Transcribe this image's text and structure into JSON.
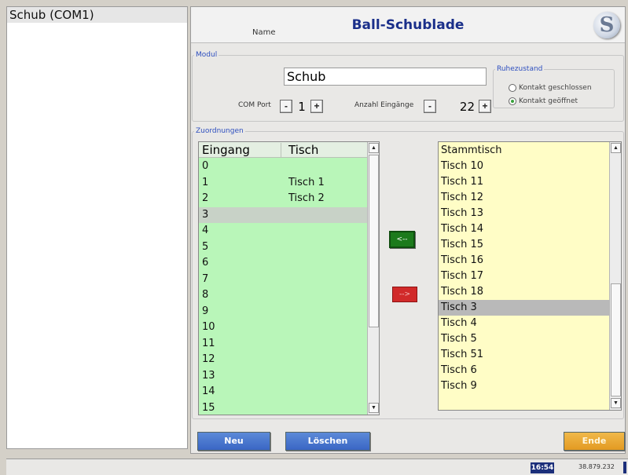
{
  "left_panel": {
    "items": [
      "Schub (COM1)"
    ]
  },
  "header": {
    "title": "Ball-Schublade",
    "logo_text": "S"
  },
  "modul": {
    "legend": "Modul",
    "name_label": "Name",
    "name_value": "Schub",
    "comport_label": "COM Port",
    "comport_value": "1",
    "inputs_label": "Anzahl Eingänge",
    "inputs_value": "22",
    "minus": "-",
    "plus": "+",
    "ruhezustand": {
      "legend": "Ruhezustand",
      "option_closed": "Kontakt geschlossen",
      "option_open": "Kontakt geöffnet",
      "selected": "open"
    }
  },
  "zuordnungen": {
    "legend": "Zuordnungen",
    "headers": [
      "Eingang",
      "Tisch"
    ],
    "eingang_rows": [
      {
        "e": "0",
        "t": ""
      },
      {
        "e": "1",
        "t": "Tisch 1"
      },
      {
        "e": "2",
        "t": "Tisch 2"
      },
      {
        "e": "3",
        "t": ""
      },
      {
        "e": "4",
        "t": ""
      },
      {
        "e": "5",
        "t": ""
      },
      {
        "e": "6",
        "t": ""
      },
      {
        "e": "7",
        "t": ""
      },
      {
        "e": "8",
        "t": ""
      },
      {
        "e": "9",
        "t": ""
      },
      {
        "e": "10",
        "t": ""
      },
      {
        "e": "11",
        "t": ""
      },
      {
        "e": "12",
        "t": ""
      },
      {
        "e": "13",
        "t": ""
      },
      {
        "e": "14",
        "t": ""
      },
      {
        "e": "15",
        "t": ""
      }
    ],
    "eingang_selected": "3",
    "assign_label": "<--",
    "remove_label": "-->",
    "tisch_rows": [
      "Stammtisch",
      "Tisch 10",
      "Tisch 11",
      "Tisch 12",
      "Tisch 13",
      "Tisch 14",
      "Tisch 15",
      "Tisch 16",
      "Tisch 17",
      "Tisch 18",
      "Tisch 3",
      "Tisch 4",
      "Tisch 5",
      "Tisch 51",
      "Tisch 6",
      "Tisch 9"
    ],
    "tisch_selected": "Tisch 3"
  },
  "buttons": {
    "neu": "Neu",
    "loeschen": "Löschen",
    "ende": "Ende"
  },
  "statusbar": {
    "clock": "16:54",
    "balance": "38.879.232"
  },
  "colors": {
    "eingang_bg": "#b9f6b9",
    "tisch_bg": "#fffdc6",
    "assign_button": "#1c7a1c",
    "remove_button": "#d12a2a",
    "primary_button": "#3a66c4",
    "exit_button": "#e39a22",
    "title_text": "#1a2f8a"
  }
}
